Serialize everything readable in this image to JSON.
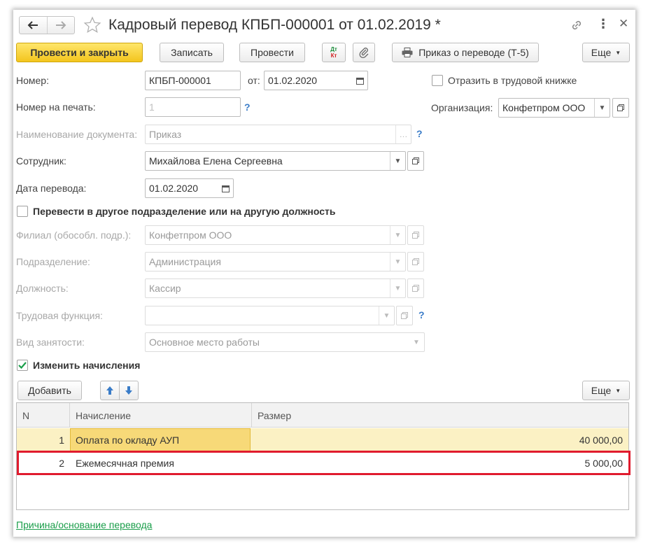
{
  "header": {
    "title": "Кадровый перевод КПБП-000001 от 01.02.2019 *"
  },
  "toolbar": {
    "post_close": "Провести и закрыть",
    "save": "Записать",
    "post": "Провести",
    "dtkt_top": "Дт",
    "dtkt_bottom": "Кт",
    "print_order": "Приказ о переводе (Т-5)",
    "more": "Еще"
  },
  "form": {
    "number_label": "Номер:",
    "number_value": "КПБП-000001",
    "from_label": "от:",
    "from_value": "01.02.2020",
    "reflect_label": "Отразить в трудовой книжке",
    "print_number_label": "Номер на печать:",
    "print_number_placeholder": "1",
    "question": "?",
    "organization_label": "Организация:",
    "organization_value": "Конфетпром ООО",
    "doc_name_label": "Наименование документа:",
    "doc_name_value": "Приказ",
    "employee_label": "Сотрудник:",
    "employee_value": "Михайлова Елена Сергеевна",
    "transfer_date_label": "Дата перевода:",
    "transfer_date_value": "01.02.2020",
    "transfer_checkbox_label": "Перевести в другое подразделение или на другую должность",
    "branch_label": "Филиал (обособл. подр.):",
    "branch_value": "Конфетпром ООО",
    "department_label": "Подразделение:",
    "department_value": "Администрация",
    "position_label": "Должность:",
    "position_value": "Кассир",
    "labor_function_label": "Трудовая функция:",
    "labor_function_value": "",
    "employment_label": "Вид занятости:",
    "employment_value": "Основное место работы",
    "change_accruals_label": "Изменить начисления"
  },
  "accruals": {
    "add": "Добавить",
    "more": "Еще",
    "columns": [
      "N",
      "Начисление",
      "Размер"
    ],
    "rows": [
      {
        "n": "1",
        "name": "Оплата по окладу АУП",
        "amount": "40 000,00"
      },
      {
        "n": "2",
        "name": "Ежемесячная премия",
        "amount": "5 000,00"
      }
    ]
  },
  "footer": {
    "reason_link": "Причина/основание перевода"
  },
  "colors": {
    "primary_button": "#f3c51d",
    "selected_row": "#fbf1c4",
    "highlight_border": "#e01b2e",
    "link": "#1a9e4a",
    "help": "#3a7cc8"
  }
}
